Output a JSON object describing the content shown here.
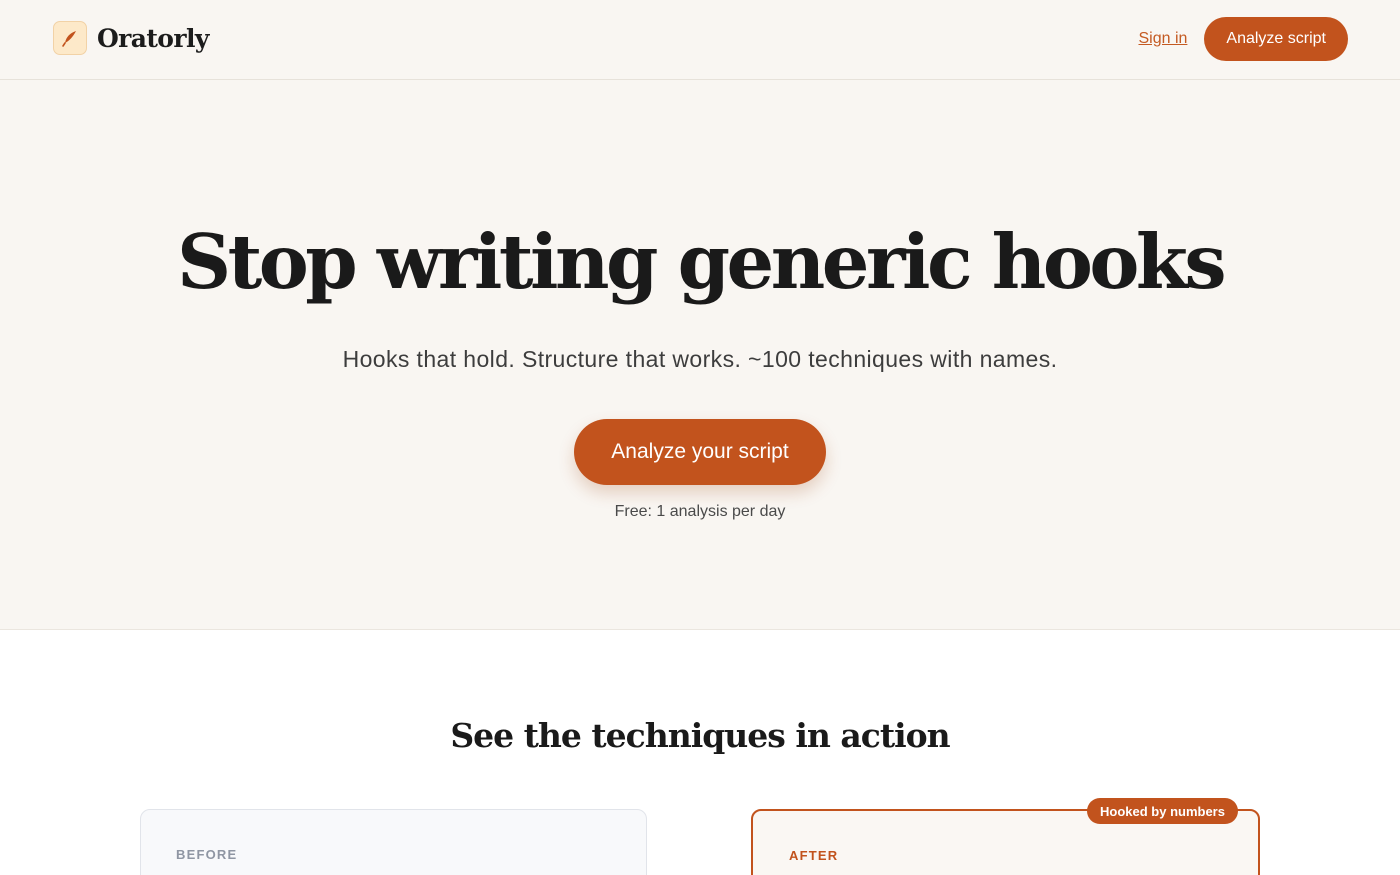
{
  "header": {
    "brand_name": "Oratorly",
    "logo_icon": "quill-icon",
    "sign_in_label": "Sign in",
    "cta_label": "Analyze script"
  },
  "hero": {
    "title": "Stop writing generic hooks",
    "subtitle": "Hooks that hold. Structure that works. ~100 techniques with names.",
    "cta_label": "Analyze your script",
    "note": "Free: 1 analysis per day"
  },
  "examples": {
    "title": "See the techniques in action",
    "before_label": "BEFORE",
    "after_label": "AFTER",
    "after_tag": "Hooked by numbers"
  },
  "colors": {
    "accent": "#c2531d",
    "hero_background": "#f9f6f2",
    "text": "#1a1a1a"
  }
}
